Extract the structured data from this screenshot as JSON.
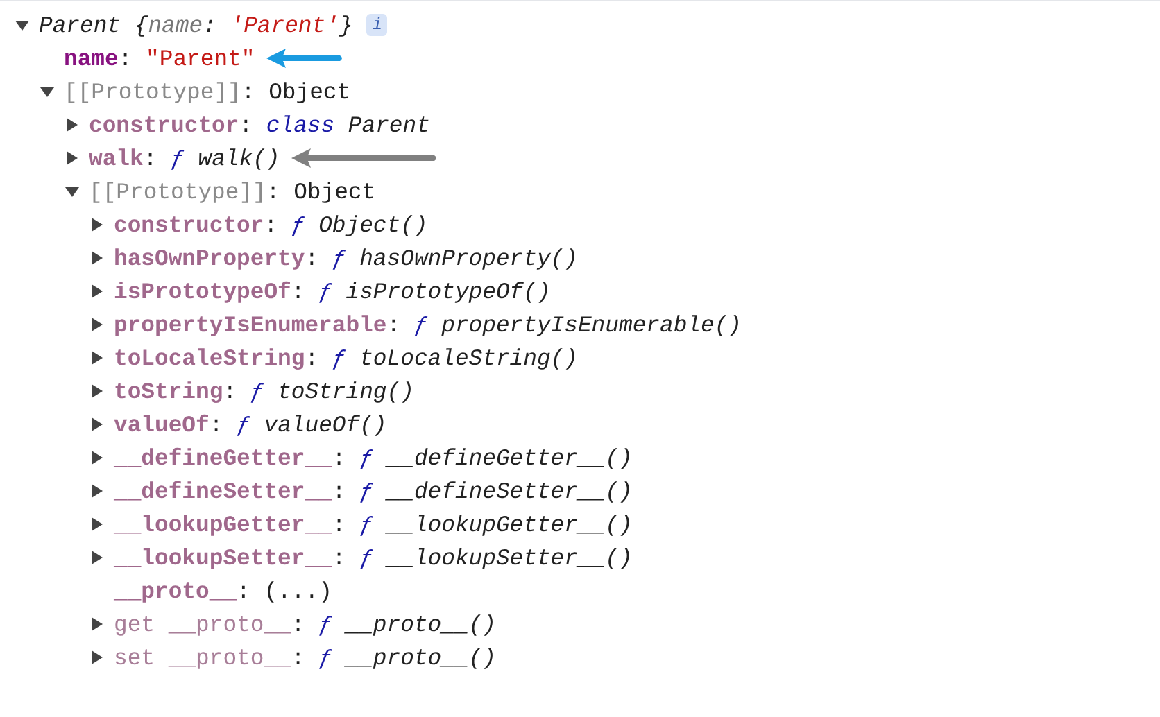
{
  "separator": ":",
  "root": {
    "expanded": true,
    "summary": [
      {
        "text": "Parent ",
        "kind": "name"
      },
      {
        "text": "{",
        "kind": "punct"
      },
      {
        "text": "name",
        "kind": "key"
      },
      {
        "text": ": ",
        "kind": "punct"
      },
      {
        "text": "'Parent'",
        "kind": "string"
      },
      {
        "text": "}",
        "kind": "punct"
      }
    ],
    "info_badge": "i",
    "children": [
      {
        "key": "name",
        "kind": "own",
        "value": {
          "kind": "string",
          "text": "\"Parent\""
        },
        "annotation": {
          "color": "#1a9be0",
          "kind": "short"
        }
      },
      {
        "key": "[[Prototype]]",
        "kind": "internal",
        "expanded": true,
        "value": {
          "kind": "object",
          "text": "Object"
        },
        "children": [
          {
            "key": "constructor",
            "kind": "inherited",
            "expanded": false,
            "value": {
              "kind": "class",
              "keyword": "class",
              "text": "Parent"
            }
          },
          {
            "key": "walk",
            "kind": "inherited",
            "expanded": false,
            "value": {
              "kind": "function",
              "keyword": "ƒ",
              "text": "walk()"
            },
            "annotation": {
              "color": "#808080",
              "kind": "long"
            }
          },
          {
            "key": "[[Prototype]]",
            "kind": "internal",
            "expanded": true,
            "value": {
              "kind": "object",
              "text": "Object"
            },
            "children": [
              {
                "key": "constructor",
                "kind": "inherited",
                "expanded": false,
                "value": {
                  "kind": "function",
                  "keyword": "ƒ",
                  "text": "Object()"
                }
              },
              {
                "key": "hasOwnProperty",
                "kind": "inherited",
                "expanded": false,
                "value": {
                  "kind": "function",
                  "keyword": "ƒ",
                  "text": "hasOwnProperty()"
                }
              },
              {
                "key": "isPrototypeOf",
                "kind": "inherited",
                "expanded": false,
                "value": {
                  "kind": "function",
                  "keyword": "ƒ",
                  "text": "isPrototypeOf()"
                }
              },
              {
                "key": "propertyIsEnumerable",
                "kind": "inherited",
                "expanded": false,
                "value": {
                  "kind": "function",
                  "keyword": "ƒ",
                  "text": "propertyIsEnumerable()"
                }
              },
              {
                "key": "toLocaleString",
                "kind": "inherited",
                "expanded": false,
                "value": {
                  "kind": "function",
                  "keyword": "ƒ",
                  "text": "toLocaleString()"
                }
              },
              {
                "key": "toString",
                "kind": "inherited",
                "expanded": false,
                "value": {
                  "kind": "function",
                  "keyword": "ƒ",
                  "text": "toString()"
                }
              },
              {
                "key": "valueOf",
                "kind": "inherited",
                "expanded": false,
                "value": {
                  "kind": "function",
                  "keyword": "ƒ",
                  "text": "valueOf()"
                }
              },
              {
                "key": "__defineGetter__",
                "kind": "inherited",
                "expanded": false,
                "value": {
                  "kind": "function",
                  "keyword": "ƒ",
                  "text": "__defineGetter__()"
                }
              },
              {
                "key": "__defineSetter__",
                "kind": "inherited",
                "expanded": false,
                "value": {
                  "kind": "function",
                  "keyword": "ƒ",
                  "text": "__defineSetter__()"
                }
              },
              {
                "key": "__lookupGetter__",
                "kind": "inherited",
                "expanded": false,
                "value": {
                  "kind": "function",
                  "keyword": "ƒ",
                  "text": "__lookupGetter__()"
                }
              },
              {
                "key": "__lookupSetter__",
                "kind": "inherited",
                "expanded": false,
                "value": {
                  "kind": "function",
                  "keyword": "ƒ",
                  "text": "__lookupSetter__()"
                }
              },
              {
                "key": "__proto__",
                "kind": "inherited",
                "value": {
                  "kind": "getter",
                  "text": "(...)"
                }
              },
              {
                "key": "get __proto__",
                "kind": "accessor",
                "expanded": false,
                "value": {
                  "kind": "function",
                  "keyword": "ƒ",
                  "text": "__proto__()"
                }
              },
              {
                "key": "set __proto__",
                "kind": "accessor",
                "expanded": false,
                "value": {
                  "kind": "function",
                  "keyword": "ƒ",
                  "text": "__proto__()"
                }
              }
            ]
          }
        ]
      }
    ]
  }
}
